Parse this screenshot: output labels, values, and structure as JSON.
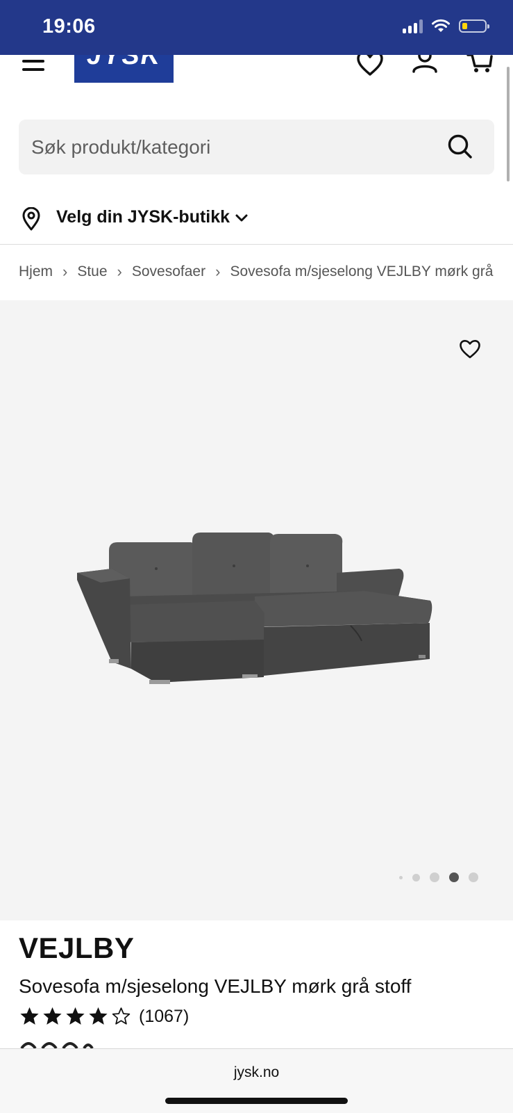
{
  "status_bar": {
    "time": "19:06",
    "battery_color": "#ffd60a"
  },
  "colors": {
    "brand_blue": "#1f3d99",
    "status_bar_bg": "#23388a",
    "gallery_bg": "#f4f4f4"
  },
  "header": {
    "logo_text": "JYSK",
    "icons": [
      "menu-icon",
      "heart-icon",
      "user-icon",
      "cart-icon"
    ]
  },
  "search": {
    "placeholder": "Søk produkt/kategori"
  },
  "store_selector": {
    "label": "Velg din JYSK-butikk"
  },
  "breadcrumb": {
    "items": [
      "Hjem",
      "Stue",
      "Sovesofaer",
      "Sovesofa m/sjeselong VEJLBY mørk grå stoff"
    ]
  },
  "gallery": {
    "image_count": 5,
    "active_index": 3
  },
  "product": {
    "brand": "VEJLBY",
    "name": "Sovesofa m/sjeselong VEJLBY mørk grå stoff",
    "rating": 4,
    "rating_max": 5,
    "review_count": "(1067)"
  },
  "browser": {
    "url": "jysk.no"
  }
}
